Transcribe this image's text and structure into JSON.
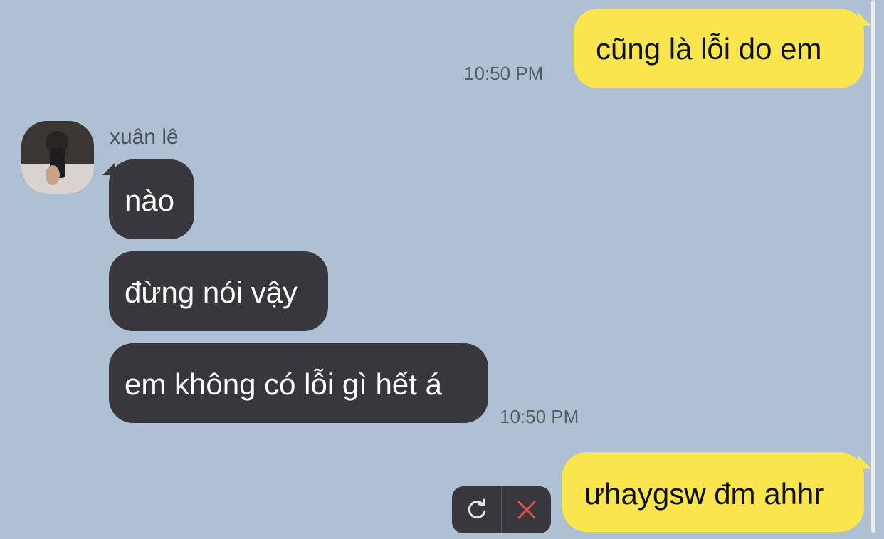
{
  "messages": {
    "m1": {
      "text": "cũng là lỗi do em",
      "time": "10:50 PM"
    },
    "sender_name": "xuân lê",
    "m2": {
      "text": "nào"
    },
    "m3": {
      "text": "đừng nói vậy"
    },
    "m4": {
      "text": "em không có lỗi gì hết á",
      "time": "10:50 PM"
    },
    "m5": {
      "text": "ưhaygsw đm ahhr"
    }
  },
  "failed_actions": {
    "retry_icon": "retry-icon",
    "delete_icon": "close-icon"
  },
  "colors": {
    "background": "#aec0d1",
    "my_bubble": "#f9e54e",
    "their_bubble": "#38383c",
    "delete_red": "#e0524a"
  }
}
